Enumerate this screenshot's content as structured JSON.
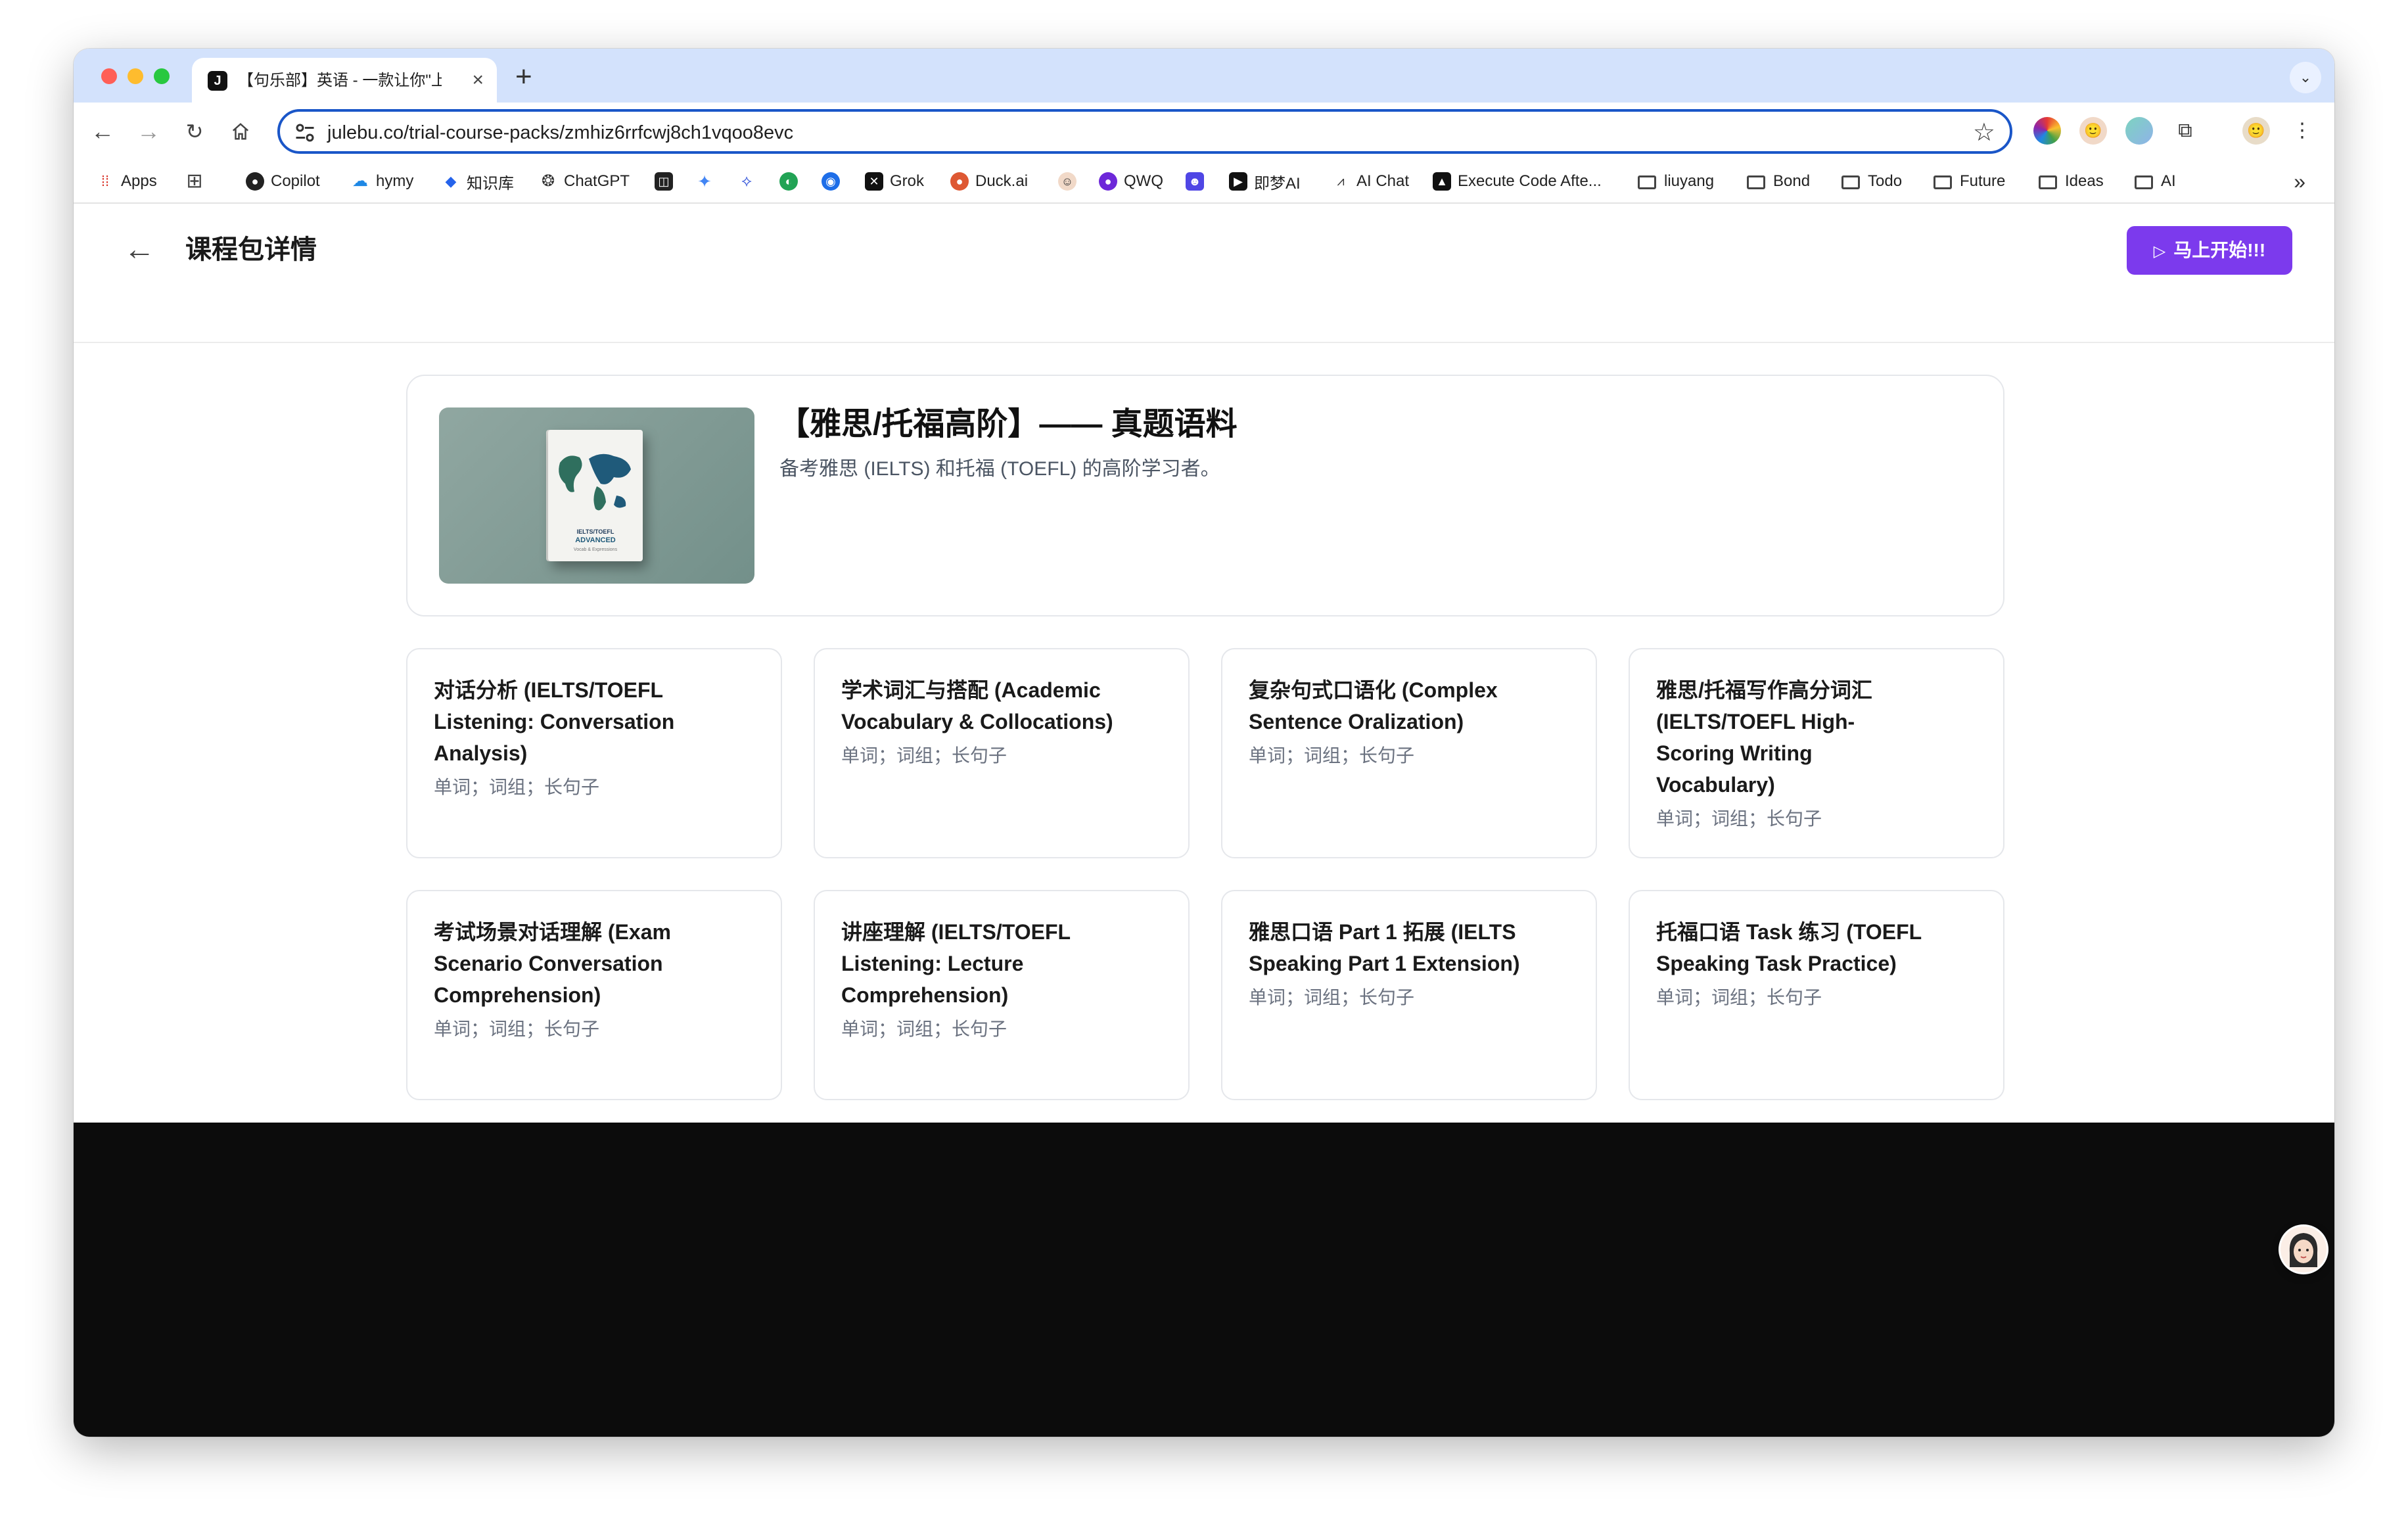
{
  "browser": {
    "tab": {
      "title": "【句乐部】英语 - 一款让你\"上瘾",
      "favicon": "J"
    },
    "new_tab": "+",
    "url": "julebu.co/trial-course-packs/zmhiz6rrfcwj8ch1vqoo8evc"
  },
  "bookmarks": {
    "apps": "Apps",
    "copilot": "Copilot",
    "hymy": "hymy",
    "zhishiku": "知识库",
    "chatgpt": "ChatGPT",
    "grok": "Grok",
    "duck": "Duck.ai",
    "qwq": "QWQ",
    "jimeng": "即梦AI",
    "aichat": "AI Chat",
    "execute": "Execute Code Afte...",
    "folders": [
      "liuyang",
      "Bond",
      "Todo",
      "Future",
      "Ideas",
      "AI"
    ]
  },
  "page": {
    "title": "课程包详情",
    "start_button": "马上开始!!!",
    "accent_color": "#7c3aed"
  },
  "hero": {
    "title": "【雅思/托福高阶】—— 真题语料",
    "subtitle": "备考雅思 (IELTS) 和托福 (TOEFL) 的高阶学习者。",
    "book": {
      "line1": "IELTS/TOEFL",
      "line2": "ADVANCED",
      "line3": "Vocab & Expressions"
    }
  },
  "courses": [
    {
      "title": "对话分析 (IELTS/TOEFL Listening: Conversation Analysis)",
      "tags": "单词；词组；长句子"
    },
    {
      "title": "学术词汇与搭配 (Academic Vocabulary & Collocations)",
      "tags": "单词；词组；长句子"
    },
    {
      "title": "复杂句式口语化 (Complex Sentence Oralization)",
      "tags": "单词；词组；长句子"
    },
    {
      "title": "雅思/托福写作高分词汇 (IELTS/TOEFL High-Scoring Writing Vocabulary)",
      "tags": "单词；词组；长句子"
    },
    {
      "title": "考试场景对话理解 (Exam Scenario Conversation Comprehension)",
      "tags": "单词；词组；长句子"
    },
    {
      "title": "讲座理解 (IELTS/TOEFL Listening: Lecture Comprehension)",
      "tags": "单词；词组；长句子"
    },
    {
      "title": "雅思口语 Part 1 拓展 (IELTS Speaking Part 1 Extension)",
      "tags": "单词；词组；长句子"
    },
    {
      "title": "托福口语 Task 练习 (TOEFL Speaking Task Practice)",
      "tags": "单词；词组；长句子"
    }
  ]
}
